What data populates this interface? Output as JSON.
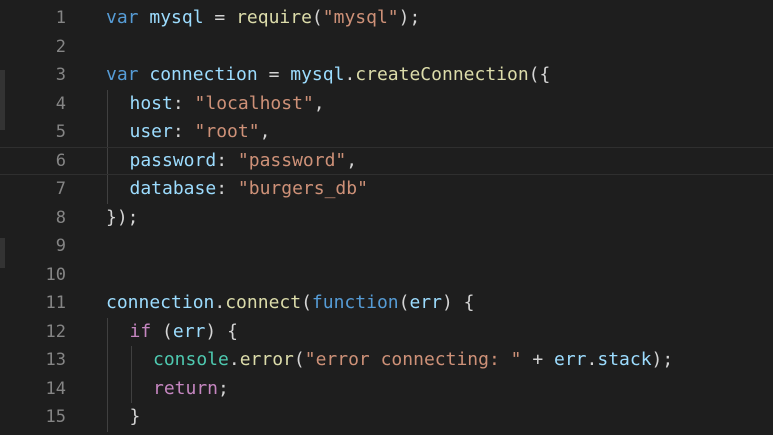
{
  "editor": {
    "language": "javascript",
    "lines": [
      {
        "number": "1",
        "tokens": [
          {
            "t": "var",
            "c": "kw"
          },
          {
            "t": " ",
            "c": "pun"
          },
          {
            "t": "mysql",
            "c": "var"
          },
          {
            "t": " = ",
            "c": "pun"
          },
          {
            "t": "require",
            "c": "fn"
          },
          {
            "t": "(",
            "c": "pun"
          },
          {
            "t": "\"mysql\"",
            "c": "str"
          },
          {
            "t": ");",
            "c": "pun"
          }
        ],
        "indent": 0
      },
      {
        "number": "2",
        "tokens": [],
        "indent": 0
      },
      {
        "number": "3",
        "tokens": [
          {
            "t": "var",
            "c": "kw"
          },
          {
            "t": " ",
            "c": "pun"
          },
          {
            "t": "connection",
            "c": "var"
          },
          {
            "t": " = ",
            "c": "pun"
          },
          {
            "t": "mysql",
            "c": "var"
          },
          {
            "t": ".",
            "c": "pun"
          },
          {
            "t": "createConnection",
            "c": "fn"
          },
          {
            "t": "({",
            "c": "pun"
          }
        ],
        "indent": 0
      },
      {
        "number": "4",
        "tokens": [
          {
            "t": "host",
            "c": "var"
          },
          {
            "t": ": ",
            "c": "pun"
          },
          {
            "t": "\"localhost\"",
            "c": "str"
          },
          {
            "t": ",",
            "c": "pun"
          }
        ],
        "indent": 1
      },
      {
        "number": "5",
        "tokens": [
          {
            "t": "user",
            "c": "var"
          },
          {
            "t": ": ",
            "c": "pun"
          },
          {
            "t": "\"root\"",
            "c": "str"
          },
          {
            "t": ",",
            "c": "pun"
          }
        ],
        "indent": 1
      },
      {
        "number": "6",
        "tokens": [
          {
            "t": "password",
            "c": "var"
          },
          {
            "t": ": ",
            "c": "pun"
          },
          {
            "t": "\"password\"",
            "c": "str"
          },
          {
            "t": ",",
            "c": "pun"
          }
        ],
        "indent": 1,
        "current": true
      },
      {
        "number": "7",
        "tokens": [
          {
            "t": "database",
            "c": "var"
          },
          {
            "t": ": ",
            "c": "pun"
          },
          {
            "t": "\"burgers_db\"",
            "c": "str"
          }
        ],
        "indent": 1
      },
      {
        "number": "8",
        "tokens": [
          {
            "t": "});",
            "c": "pun"
          }
        ],
        "indent": 0
      },
      {
        "number": "9",
        "tokens": [],
        "indent": 0
      },
      {
        "number": "10",
        "tokens": [],
        "indent": 0
      },
      {
        "number": "11",
        "tokens": [
          {
            "t": "connection",
            "c": "var"
          },
          {
            "t": ".",
            "c": "pun"
          },
          {
            "t": "connect",
            "c": "fn"
          },
          {
            "t": "(",
            "c": "pun"
          },
          {
            "t": "function",
            "c": "kw"
          },
          {
            "t": "(",
            "c": "pun"
          },
          {
            "t": "err",
            "c": "var"
          },
          {
            "t": ") {",
            "c": "pun"
          }
        ],
        "indent": 0
      },
      {
        "number": "12",
        "tokens": [
          {
            "t": "if",
            "c": "kw2"
          },
          {
            "t": " (",
            "c": "pun"
          },
          {
            "t": "err",
            "c": "var"
          },
          {
            "t": ") {",
            "c": "pun"
          }
        ],
        "indent": 1
      },
      {
        "number": "13",
        "tokens": [
          {
            "t": "console",
            "c": "obj"
          },
          {
            "t": ".",
            "c": "pun"
          },
          {
            "t": "error",
            "c": "fn"
          },
          {
            "t": "(",
            "c": "pun"
          },
          {
            "t": "\"error connecting: \"",
            "c": "str"
          },
          {
            "t": " + ",
            "c": "pun"
          },
          {
            "t": "err",
            "c": "var"
          },
          {
            "t": ".",
            "c": "pun"
          },
          {
            "t": "stack",
            "c": "var"
          },
          {
            "t": ");",
            "c": "pun"
          }
        ],
        "indent": 2
      },
      {
        "number": "14",
        "tokens": [
          {
            "t": "return",
            "c": "kw2"
          },
          {
            "t": ";",
            "c": "pun"
          }
        ],
        "indent": 2
      },
      {
        "number": "15",
        "tokens": [
          {
            "t": "}",
            "c": "pun"
          }
        ],
        "indent": 1
      }
    ]
  },
  "colors": {
    "background": "#1e1e1e",
    "line_number": "#858585",
    "keyword": "#569cd6",
    "control_keyword": "#c586c0",
    "variable": "#9cdcfe",
    "function": "#dcdcaa",
    "string": "#ce9178",
    "punctuation": "#d4d4d4",
    "type": "#4ec9b0"
  }
}
